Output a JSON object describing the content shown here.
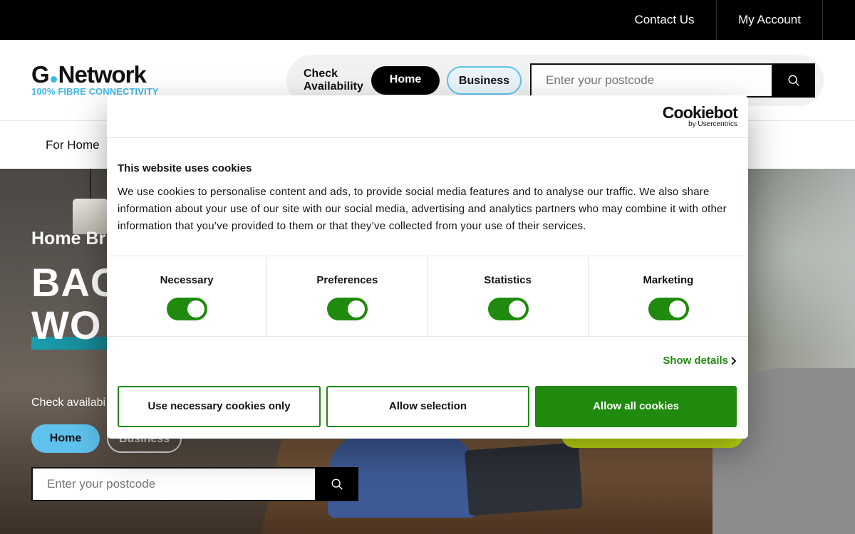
{
  "topbar": {
    "contact": "Contact Us",
    "account": "My Account"
  },
  "logo": {
    "name_left": "G",
    "name_right": "Network",
    "tagline": "100% FIBRE CONNECTIVITY"
  },
  "header": {
    "check_label": "Check Availability",
    "home_pill": "Home",
    "business_pill": "Business",
    "postcode_placeholder": "Enter your postcode"
  },
  "nav": {
    "for_home": "For Home"
  },
  "hero": {
    "subtitle": "Home Br",
    "headline_line1": "BAC",
    "headline_line2": "WO",
    "check_text": "Check availabi",
    "home_pill": "Home",
    "business_pill": "Business",
    "postcode_placeholder": "Enter your postcode"
  },
  "cookie": {
    "brand": "Cookiebot",
    "brand_by": "by Usercentrics",
    "title": "This website uses cookies",
    "body": "We use cookies to personalise content and ads, to provide social media features and to analyse our traffic. We also share information about your use of our site with our social media, advertising and analytics partners who may combine it with other information that you’ve provided to them or that they’ve collected from your use of their services.",
    "categories": [
      {
        "label": "Necessary",
        "enabled": true
      },
      {
        "label": "Preferences",
        "enabled": true
      },
      {
        "label": "Statistics",
        "enabled": true
      },
      {
        "label": "Marketing",
        "enabled": true
      }
    ],
    "show_details": "Show details",
    "btn_necessary": "Use necessary cookies only",
    "btn_selection": "Allow selection",
    "btn_all": "Allow all cookies"
  },
  "colors": {
    "accent_green": "#1f8a0d",
    "brand_blue": "#3fb7e8",
    "lime": "#c6e012"
  }
}
